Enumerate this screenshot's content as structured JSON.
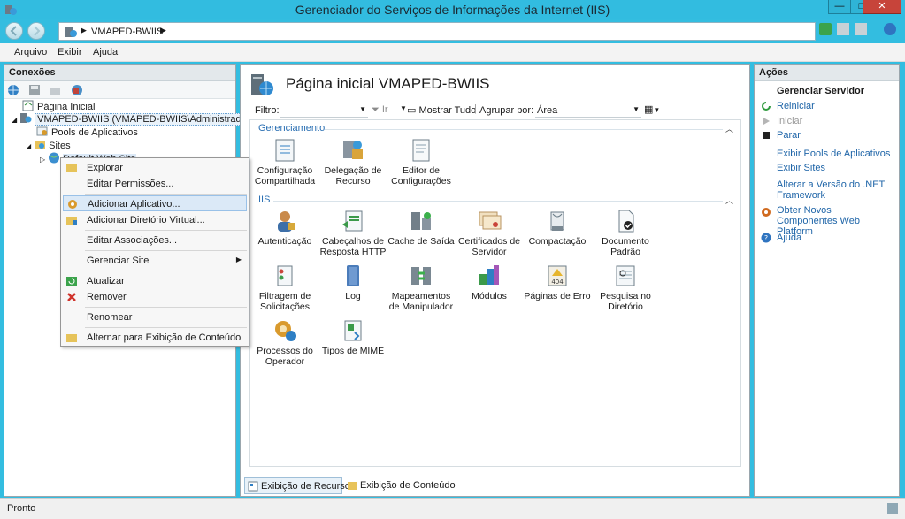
{
  "window": {
    "title": "Gerenciador do Serviços de Informações da Internet (IIS)"
  },
  "address": {
    "server": "VMAPED-BWIIS"
  },
  "menubar": {
    "items": [
      "Arquivo",
      "Exibir",
      "Ajuda"
    ]
  },
  "connections": {
    "title": "Conexões",
    "tree": {
      "start_page": "Página Inicial",
      "server": "VMAPED-BWIIS (VMAPED-BWIIS\\Administrador)",
      "app_pools": "Pools de Aplicativos",
      "sites": "Sites",
      "default_site": "Default Web Site"
    }
  },
  "main": {
    "title": "Página inicial VMAPED-BWIIS",
    "filter": {
      "label": "Filtro:",
      "go": "Ir",
      "show_all": "Mostrar Tudo",
      "group_label": "Agrupar por:",
      "group_value": "Área"
    },
    "sections": {
      "management": {
        "title": "Gerenciamento",
        "items": [
          {
            "label": "Configuração Compartilhada",
            "icon": "shared-config-icon"
          },
          {
            "label": "Delegação de Recurso",
            "icon": "feature-delegation-icon"
          },
          {
            "label": "Editor de Configurações",
            "icon": "config-editor-icon"
          }
        ]
      },
      "iis": {
        "title": "IIS",
        "items": [
          {
            "label": "Autenticação",
            "icon": "authentication-icon"
          },
          {
            "label": "Cabeçalhos de Resposta HTTP",
            "icon": "http-headers-icon"
          },
          {
            "label": "Cache de Saída",
            "icon": "output-cache-icon"
          },
          {
            "label": "Certificados de Servidor",
            "icon": "server-certificates-icon"
          },
          {
            "label": "Compactação",
            "icon": "compression-icon"
          },
          {
            "label": "Documento Padrão",
            "icon": "default-document-icon"
          },
          {
            "label": "Filtragem de Solicitações",
            "icon": "request-filtering-icon"
          },
          {
            "label": "Log",
            "icon": "logging-icon"
          },
          {
            "label": "Mapeamentos de Manipulador",
            "icon": "handler-mappings-icon"
          },
          {
            "label": "Módulos",
            "icon": "modules-icon"
          },
          {
            "label": "Páginas de Erro",
            "icon": "error-pages-icon"
          },
          {
            "label": "Pesquisa no Diretório",
            "icon": "directory-browsing-icon"
          },
          {
            "label": "Processos do Operador",
            "icon": "worker-processes-icon"
          },
          {
            "label": "Tipos de MIME",
            "icon": "mime-types-icon"
          }
        ]
      }
    },
    "bottom_tabs": {
      "features": "Exibição de Recursos",
      "content": "Exibição de Conteúdo"
    }
  },
  "actions": {
    "title": "Ações",
    "group_title": "Gerenciar Servidor",
    "restart": "Reiniciar",
    "start": "Iniciar",
    "stop": "Parar",
    "view_pools": "Exibir Pools de Aplicativos",
    "view_sites": "Exibir Sites",
    "change_net": "Alterar a Versão do .NET Framework",
    "get_components": "Obter Novos Componentes Web Platform",
    "help": "Ajuda"
  },
  "context_menu": {
    "explore": "Explorar",
    "edit_permissions": "Editar Permissões...",
    "add_application": "Adicionar Aplicativo...",
    "add_virtual_dir": "Adicionar Diretório Virtual...",
    "edit_bindings": "Editar Associações...",
    "manage_site": "Gerenciar Site",
    "refresh": "Atualizar",
    "remove": "Remover",
    "rename": "Renomear",
    "switch_content": "Alternar para Exibição de Conteúdo"
  },
  "status": {
    "text": "Pronto"
  },
  "colors": {
    "titlebar": "#32bce0",
    "link": "#1f65a8",
    "section": "#2a6fb3",
    "highlight": "#dbe9f7"
  }
}
